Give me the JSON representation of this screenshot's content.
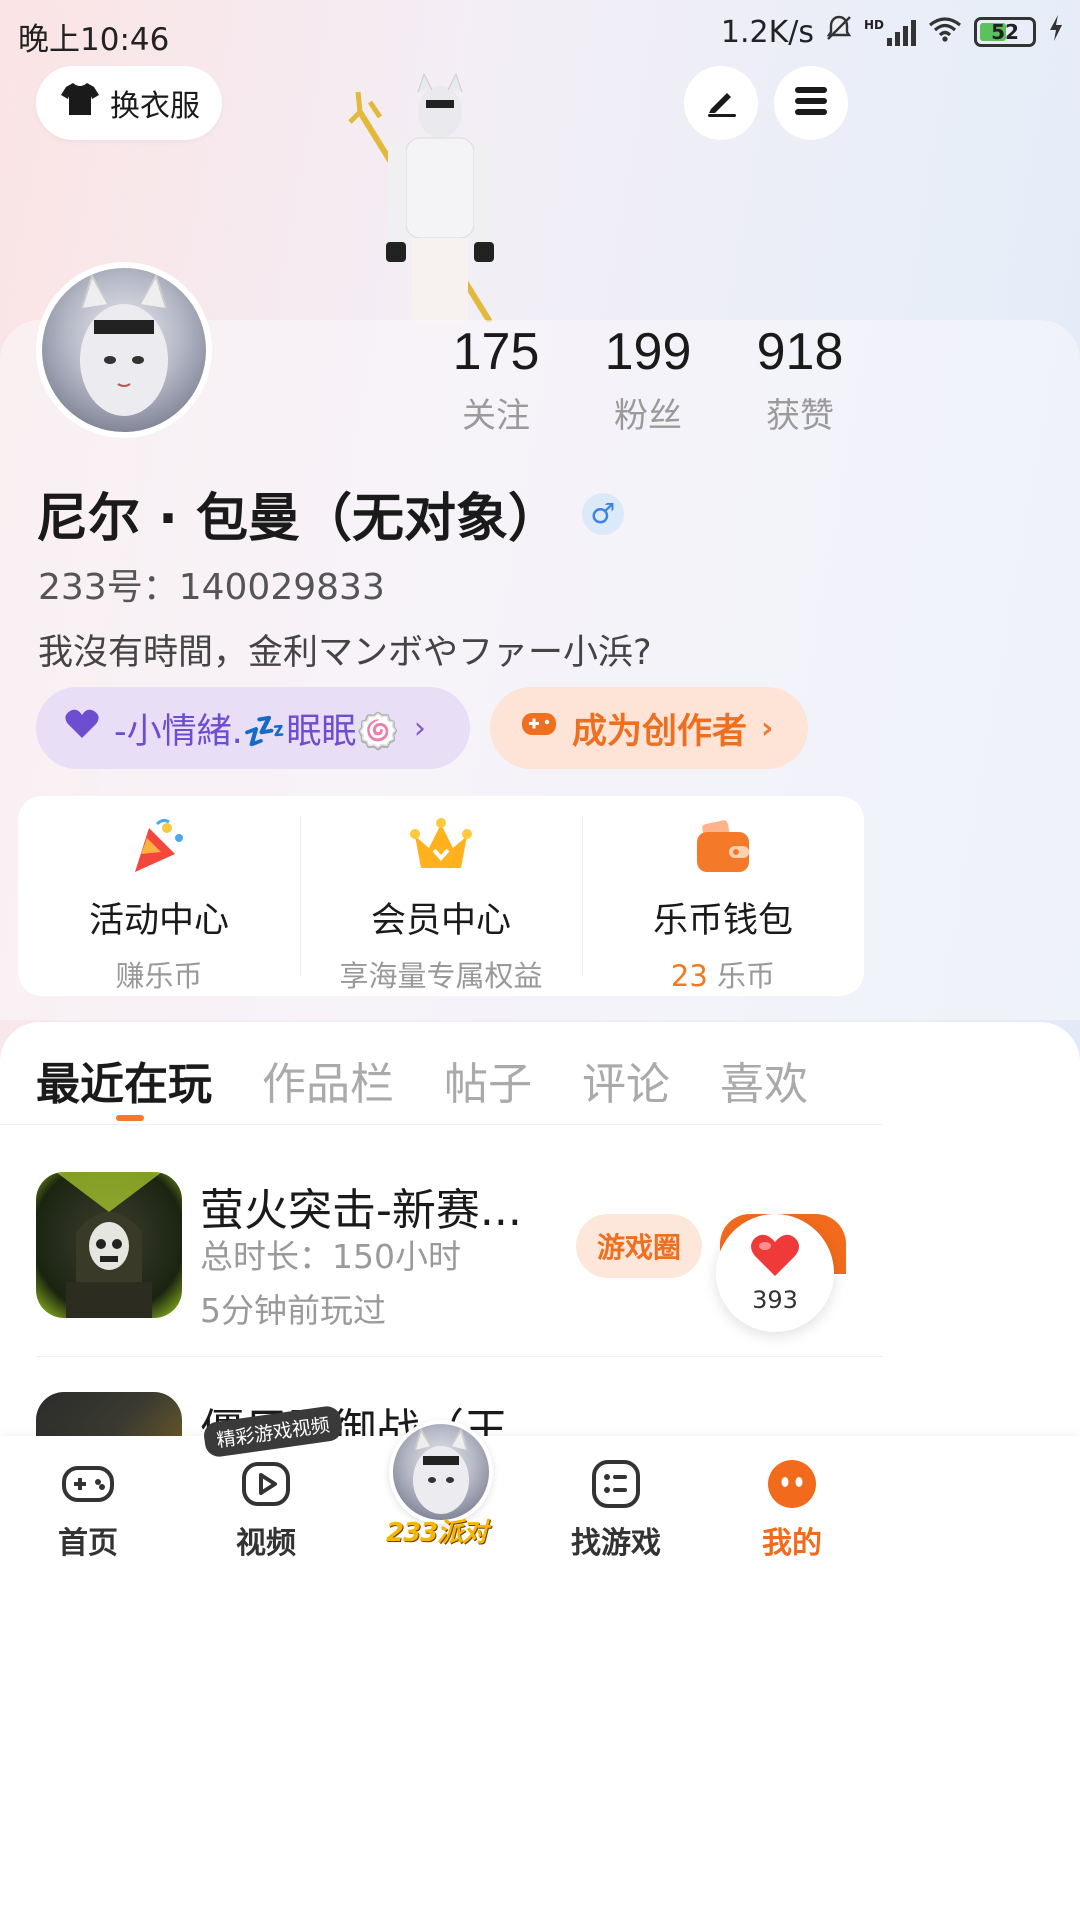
{
  "status_bar": {
    "time": "晚上10:46",
    "speed": "1.2K/s",
    "network": "HD",
    "battery": "52",
    "battery_level": 52
  },
  "header": {
    "outfit_label": "换衣服"
  },
  "profile": {
    "stats": [
      {
        "value": "175",
        "label": "关注"
      },
      {
        "value": "199",
        "label": "粉丝"
      },
      {
        "value": "918",
        "label": "获赞"
      }
    ],
    "name": "尼尔 · 包曼（无对象）",
    "gender_symbol": "♂",
    "id_text": "233号：140029833",
    "bio": "我沒有時間，金利マンボやファー小浜?",
    "mood_label": "-小情緒.💤眠眠🍥",
    "creator_label": "成为创作者"
  },
  "features": [
    {
      "title": "活动中心",
      "subtitle": "赚乐币"
    },
    {
      "title": "会员中心",
      "subtitle": "享海量专属权益"
    },
    {
      "title": "乐币钱包",
      "subtitle_num": "23",
      "subtitle_unit": "乐币"
    }
  ],
  "tabs": [
    "最近在玩",
    "作品栏",
    "帖子",
    "评论",
    "喜欢"
  ],
  "active_tab": 0,
  "games": [
    {
      "title": "萤火突击-新赛...",
      "duration": "总时长：150小时",
      "last_played": "5分钟前玩过",
      "circle_btn": "游戏圈"
    },
    {
      "title": "僵尸防御战（王..."
    }
  ],
  "like_badge": {
    "count": "393"
  },
  "bottom_nav": {
    "items": [
      "首页",
      "视频",
      "找游戏",
      "我的"
    ],
    "center_label": "233派对",
    "tag_bubble": "精彩游戏视频",
    "active": "我的"
  },
  "colors": {
    "accent": "#f26b1d",
    "mood_purple": "#6b4fd0",
    "gender_blue": "#3c84e2"
  }
}
